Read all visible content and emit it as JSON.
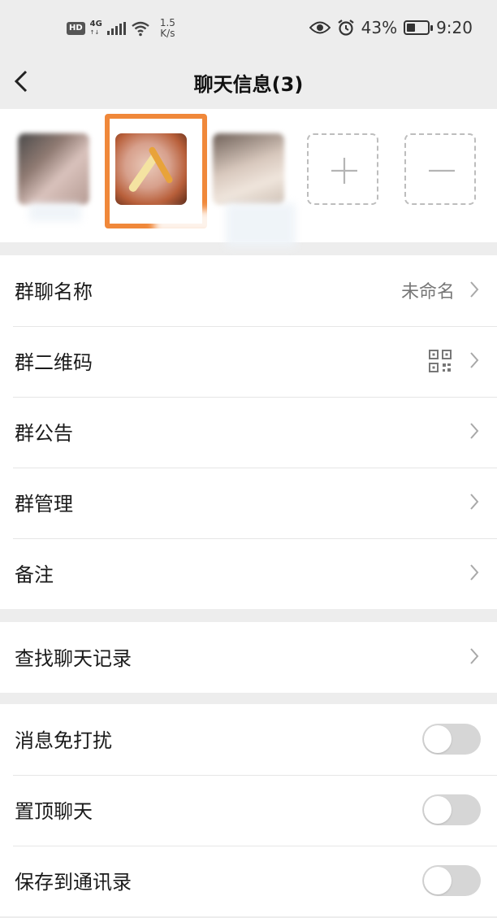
{
  "status_bar": {
    "hd": "HD",
    "network": "4G",
    "network_sub": "↑↓",
    "speed_value": "1.5",
    "speed_unit": "K/s",
    "battery": "43%",
    "battery_level": 0.43,
    "time": "9:20"
  },
  "header": {
    "title": "聊天信息(3)"
  },
  "members": {
    "count": 3,
    "highlight_color": "#f0883a"
  },
  "settings": {
    "group_name": {
      "label": "群聊名称",
      "value": "未命名"
    },
    "qr_code": {
      "label": "群二维码"
    },
    "announcement": {
      "label": "群公告"
    },
    "management": {
      "label": "群管理"
    },
    "remark": {
      "label": "备注"
    },
    "search_history": {
      "label": "查找聊天记录"
    },
    "mute": {
      "label": "消息免打扰",
      "on": false
    },
    "pin": {
      "label": "置顶聊天",
      "on": false
    },
    "save_contacts": {
      "label": "保存到通讯录",
      "on": false
    }
  }
}
